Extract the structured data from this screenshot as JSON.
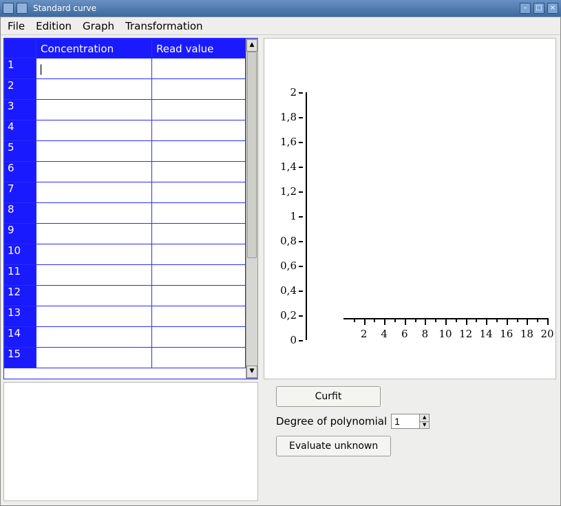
{
  "window": {
    "title": "Standard curve"
  },
  "menu": {
    "items": [
      "File",
      "Edition",
      "Graph",
      "Transformation"
    ]
  },
  "table": {
    "headers": {
      "col1": "Concentration",
      "col2": "Read value"
    },
    "rows": [
      {
        "n": "1",
        "c": "",
        "v": ""
      },
      {
        "n": "2",
        "c": "",
        "v": ""
      },
      {
        "n": "3",
        "c": "",
        "v": ""
      },
      {
        "n": "4",
        "c": "",
        "v": ""
      },
      {
        "n": "5",
        "c": "",
        "v": ""
      },
      {
        "n": "6",
        "c": "",
        "v": ""
      },
      {
        "n": "7",
        "c": "",
        "v": ""
      },
      {
        "n": "8",
        "c": "",
        "v": ""
      },
      {
        "n": "9",
        "c": "",
        "v": ""
      },
      {
        "n": "10",
        "c": "",
        "v": ""
      },
      {
        "n": "11",
        "c": "",
        "v": ""
      },
      {
        "n": "12",
        "c": "",
        "v": ""
      },
      {
        "n": "13",
        "c": "",
        "v": ""
      },
      {
        "n": "14",
        "c": "",
        "v": ""
      },
      {
        "n": "15",
        "c": "",
        "v": ""
      }
    ]
  },
  "buttons": {
    "curfit": "Curfit",
    "evaluate": "Evaluate unknown"
  },
  "degree": {
    "label": "Degree of polynomial",
    "value": "1"
  },
  "chart_data": {
    "type": "scatter",
    "series": [],
    "x_ticks": [
      2,
      4,
      6,
      8,
      10,
      12,
      14,
      16,
      18,
      20
    ],
    "y_ticks": [
      "0",
      "0,2",
      "0,4",
      "0,6",
      "0,8",
      "1",
      "1,2",
      "1,4",
      "1,6",
      "1,8",
      "2"
    ],
    "xlim": [
      0,
      20
    ],
    "ylim": [
      0,
      2
    ],
    "title": "",
    "xlabel": "",
    "ylabel": ""
  },
  "titlebar_buttons": {
    "min": "–",
    "max": "□",
    "close": "×"
  },
  "scroll": {
    "up": "▲",
    "down": "▼"
  },
  "spin": {
    "up": "▲",
    "down": "▼"
  }
}
